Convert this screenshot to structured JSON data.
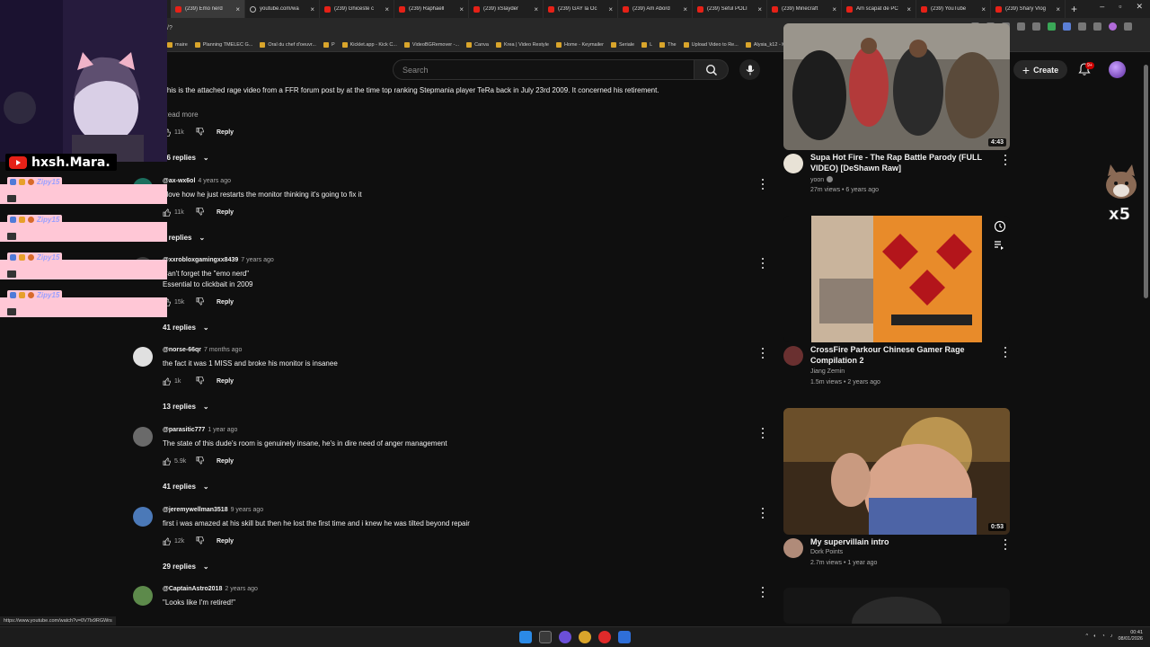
{
  "browser": {
    "tabs": [
      {
        "label": "(239) Emo nerd",
        "active": true,
        "icon": "youtube"
      },
      {
        "label": "youtube.com/wa",
        "active": false,
        "icon": "globe"
      },
      {
        "label": "(239) Ghiceste c",
        "active": false,
        "icon": "youtube"
      },
      {
        "label": "(239) Raphaell",
        "active": false,
        "icon": "youtube"
      },
      {
        "label": "(239) xSlayder",
        "active": false,
        "icon": "youtube"
      },
      {
        "label": "(239) GAY la Oc",
        "active": false,
        "icon": "youtube"
      },
      {
        "label": "(239) Am Abord",
        "active": false,
        "icon": "youtube"
      },
      {
        "label": "(239) Seful POLI",
        "active": false,
        "icon": "youtube"
      },
      {
        "label": "(239) Minecraft",
        "active": false,
        "icon": "youtube"
      },
      {
        "label": "Am scapat de PC",
        "active": false,
        "icon": "youtube"
      },
      {
        "label": "(239) YouTube",
        "active": false,
        "icon": "youtube"
      },
      {
        "label": "(239) Shary Vlog",
        "active": false,
        "icon": "youtube"
      }
    ],
    "new_tab": "+",
    "url": "/?",
    "bookmarks": [
      "maire",
      "Planning TMELEC G...",
      "Oral du chef d'oeuvr...",
      "P",
      "Kicklet.app - Kick C...",
      "VideoBGRemover -...",
      "Canva",
      "Krea | Video Restyle",
      "Home - Keymailer",
      "Seriale",
      "L",
      "The",
      "Upload Video to Re...",
      "Alysia_k12 - KickBot"
    ],
    "status_url": "https://www.youtube.com/watch?v=0V7lx9RGWrs"
  },
  "header": {
    "search_placeholder": "Search",
    "create_label": "Create",
    "notif_badge": "9+"
  },
  "description": {
    "text": "This is the attached rage video from a FFR forum post by at the time top ranking Stepmania player TeRa back in July 23rd 2009. It concerned his retirement.",
    "read_more": "Read more",
    "likes": "11k",
    "reply": "Reply",
    "replies": "96 replies"
  },
  "comments": [
    {
      "handle": "@ax-wx6ol",
      "time": "4 years ago",
      "lines": [
        "I love how he just restarts the monitor thinking it's going to fix it"
      ],
      "likes": "11k",
      "reply": "Reply",
      "replies": "1 replies",
      "avatar_letter": "a",
      "avatar_color": "#1b6f5e"
    },
    {
      "handle": "@xxrobloxgamingxx8439",
      "time": "7 years ago",
      "lines": [
        "Can't forget the \"emo nerd\"",
        "Essential to clickbait in 2009"
      ],
      "likes": "15k",
      "reply": "Reply",
      "replies": "41 replies",
      "avatar_letter": "",
      "avatar_color": "#3a3a3a"
    },
    {
      "handle": "@norse-66qr",
      "time": "7 months ago",
      "lines": [
        "the fact it was 1 MISS and broke his monitor is insanee"
      ],
      "likes": "1k",
      "reply": "Reply",
      "replies": "13 replies",
      "avatar_letter": "",
      "avatar_color": "#e0e0e0"
    },
    {
      "handle": "@parasitic777",
      "time": "1 year ago",
      "lines": [
        "The state of this dude's room is genuinely insane, he's in dire need of anger management"
      ],
      "likes": "5.9k",
      "reply": "Reply",
      "replies": "41 replies",
      "avatar_letter": "",
      "avatar_color": "#6a6a6a"
    },
    {
      "handle": "@jeremywellman3518",
      "time": "9 years ago",
      "lines": [
        "first i was amazed at his skill but then he lost the first time and i knew he was tilted beyond repair"
      ],
      "likes": "12k",
      "reply": "Reply",
      "replies": "29 replies",
      "avatar_letter": "",
      "avatar_color": "#4b79b8"
    },
    {
      "handle": "@CaptainAstro2018",
      "time": "2 years ago",
      "lines": [
        "\"Looks like I'm retired!\""
      ],
      "likes": "",
      "reply": "",
      "replies": "",
      "avatar_letter": "",
      "avatar_color": "#5d8a4b"
    }
  ],
  "videos": [
    {
      "title": "Supa Hot Fire - The Rap Battle Parody (FULL VIDEO) [DeShawn Raw]",
      "channel": "yoon",
      "meta": "27m views • 6 years ago",
      "duration": "4:43"
    },
    {
      "title": "CrossFire Parkour Chinese Gamer Rage Compilation 2",
      "channel": "Jiang Zemin",
      "meta": "1.5m views • 2 years ago",
      "duration": ""
    },
    {
      "title": "My supervillain intro",
      "channel": "Dork Points",
      "meta": "2.7m views • 1 year ago",
      "duration": "0:53"
    }
  ],
  "overlay": {
    "streamer_name": "hxsh.Mara.",
    "chat_user": "Zipy15",
    "sticker_text": "x5"
  },
  "taskbar": {
    "time": "00:41",
    "date": "08/01/2026"
  }
}
